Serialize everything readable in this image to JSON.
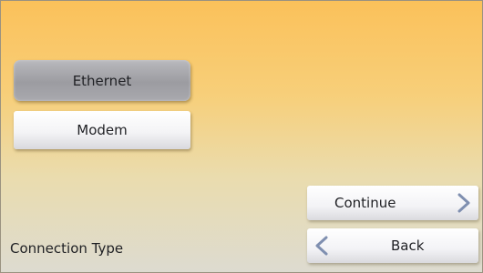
{
  "connection_options": {
    "ethernet_label": "Ethernet",
    "modem_label": "Modem",
    "selected": "Ethernet"
  },
  "navigation": {
    "continue_label": "Continue",
    "continue_icon": "chevron-right-icon",
    "back_label": "Back",
    "back_icon": "chevron-left-icon"
  },
  "screen": {
    "title": "Connection Type"
  },
  "colors": {
    "background_top": "#fbc15a",
    "background_bottom": "#dddbd0",
    "chevron": "#7f8fb0",
    "selected_button": "#a5a5aa"
  }
}
